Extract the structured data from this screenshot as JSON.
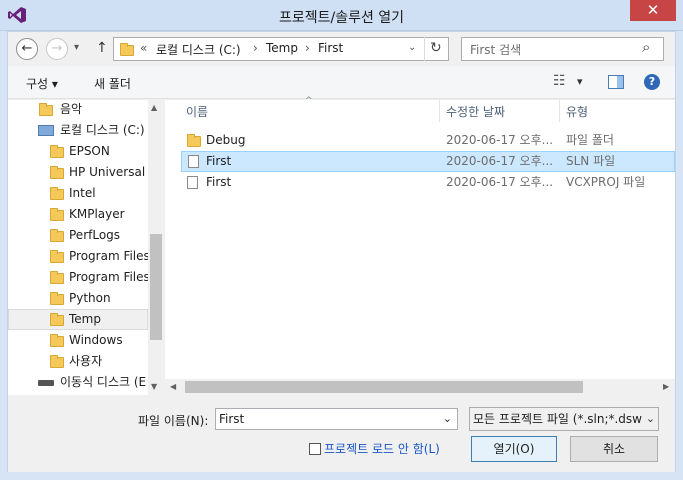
{
  "window": {
    "title": "프로젝트/솔루션 열기",
    "close_glyph": "✕"
  },
  "nav": {
    "back_glyph": "←",
    "forward_glyph": "→",
    "up_glyph": "↑",
    "breadcrumb_prefix": "«",
    "breadcrumb": [
      "로컬 디스크 (C:)",
      "Temp",
      "First"
    ],
    "separator": "›",
    "refresh_glyph": "↻",
    "search_placeholder": "First 검색",
    "search_glyph": "⌕"
  },
  "toolbar": {
    "organize_label": "구성 ▾",
    "new_folder_label": "새 폴더",
    "view_glyph": "☷",
    "view_dropdown_glyph": "▾",
    "help_glyph": "?"
  },
  "tree": [
    {
      "label": "음악",
      "icon": "music-folder"
    },
    {
      "label": "로컬 디스크 (C:)",
      "icon": "drive"
    },
    {
      "label": "EPSON",
      "icon": "folder"
    },
    {
      "label": "HP Universal P",
      "icon": "folder"
    },
    {
      "label": "Intel",
      "icon": "folder"
    },
    {
      "label": "KMPlayer",
      "icon": "folder"
    },
    {
      "label": "PerfLogs",
      "icon": "folder"
    },
    {
      "label": "Program Files",
      "icon": "folder"
    },
    {
      "label": "Program Files (",
      "icon": "folder"
    },
    {
      "label": "Python",
      "icon": "folder"
    },
    {
      "label": "Temp",
      "icon": "folder",
      "selected": true
    },
    {
      "label": "Windows",
      "icon": "folder"
    },
    {
      "label": "사용자",
      "icon": "folder"
    },
    {
      "label": "이동식 디스크 (E",
      "icon": "removable-drive"
    }
  ],
  "columns": {
    "name": "이름",
    "modified": "수정한 날짜",
    "type": "유형",
    "sort_glyph": "^"
  },
  "files": [
    {
      "name": "Debug",
      "modified": "2020-06-17 오후...",
      "type": "파일 폴더",
      "icon": "folder"
    },
    {
      "name": "First",
      "modified": "2020-06-17 오후...",
      "type": "SLN 파일",
      "icon": "file",
      "selected": true
    },
    {
      "name": "First",
      "modified": "2020-06-17 오후...",
      "type": "VCXPROJ 파일",
      "icon": "file"
    }
  ],
  "scroll": {
    "up_glyph": "▲",
    "down_glyph": "▼",
    "left_glyph": "◀",
    "right_glyph": "▶"
  },
  "footer": {
    "filename_label": "파일 이름(N):",
    "filename_value": "First",
    "dropdown_glyph": "⌄",
    "filter_value": "모든 프로젝트 파일 (*.sln;*.dsw",
    "load_project_label": "프로젝트 로드 안 함(L)",
    "open_label": "열기(O)",
    "cancel_label": "취소"
  },
  "colors": {
    "accent": "#3c7fb1",
    "selection": "#cce8ff",
    "close_red": "#c74545",
    "vs_purple": "#68217a"
  }
}
